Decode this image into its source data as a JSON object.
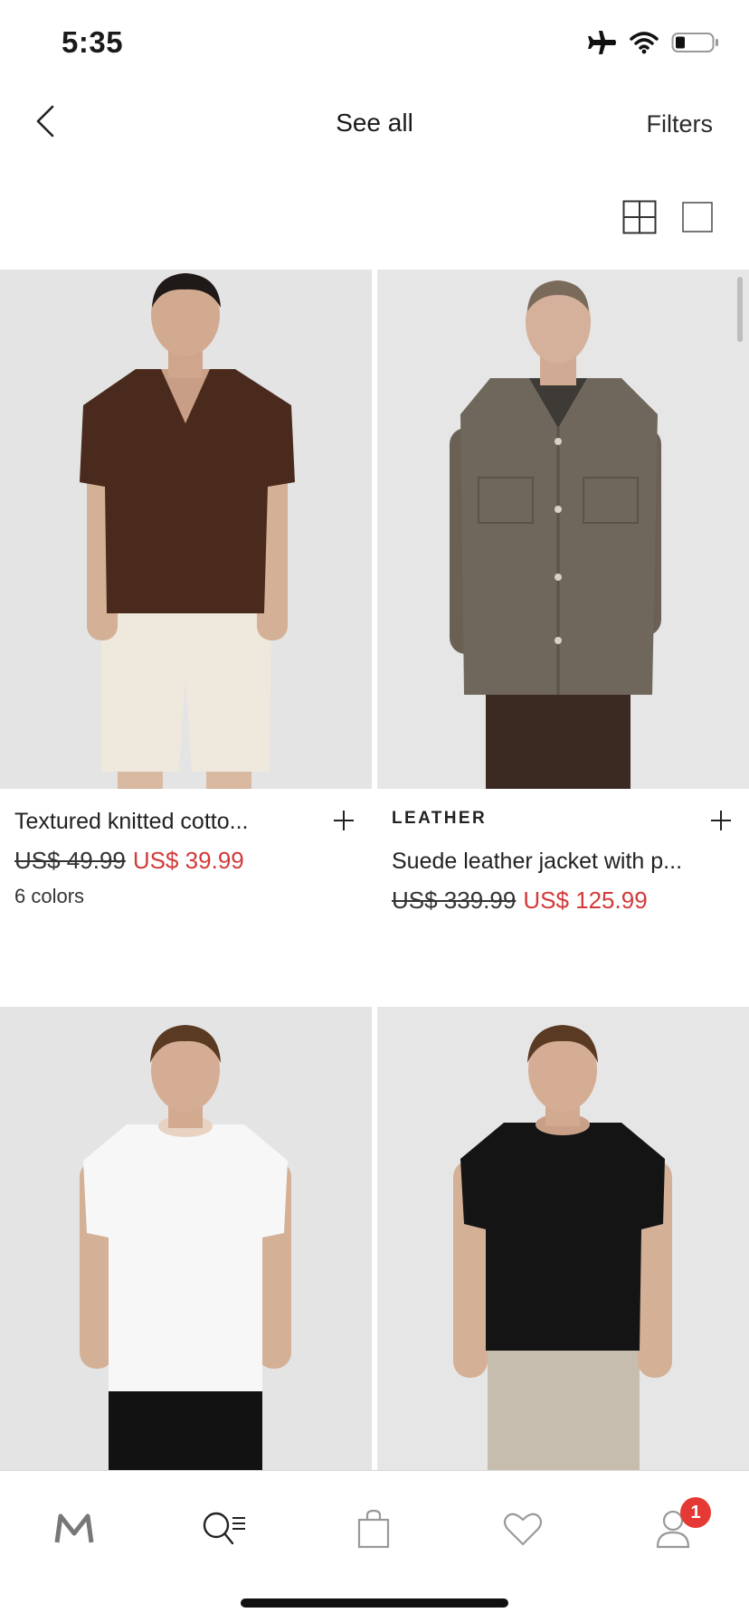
{
  "status": {
    "time": "5:35",
    "icons": [
      "airplane-icon",
      "wifi-icon",
      "battery-icon"
    ]
  },
  "header": {
    "title": "See all",
    "filters_label": "Filters"
  },
  "view_toggles": [
    "grid-view-icon",
    "single-view-icon"
  ],
  "products": [
    {
      "brand": "",
      "title": "Textured knitted cotto...",
      "old_price": "US$ 49.99",
      "new_price": "US$ 39.99",
      "colors": "6 colors"
    },
    {
      "brand": "LEATHER",
      "title": "Suede leather jacket with p...",
      "old_price": "US$ 339.99",
      "new_price": "US$ 125.99",
      "colors": ""
    },
    {
      "brand": "",
      "title": "",
      "old_price": "",
      "new_price": "",
      "colors": ""
    },
    {
      "brand": "",
      "title": "",
      "old_price": "",
      "new_price": "",
      "colors": ""
    }
  ],
  "tabbar": {
    "items": [
      "home-logo-icon",
      "search-menu-icon",
      "bag-icon",
      "heart-icon",
      "profile-icon"
    ],
    "profile_badge": "1"
  },
  "colors": {
    "sale": "#d33a3a",
    "badge": "#e53935",
    "photo_bg": "#e6e6e6"
  }
}
